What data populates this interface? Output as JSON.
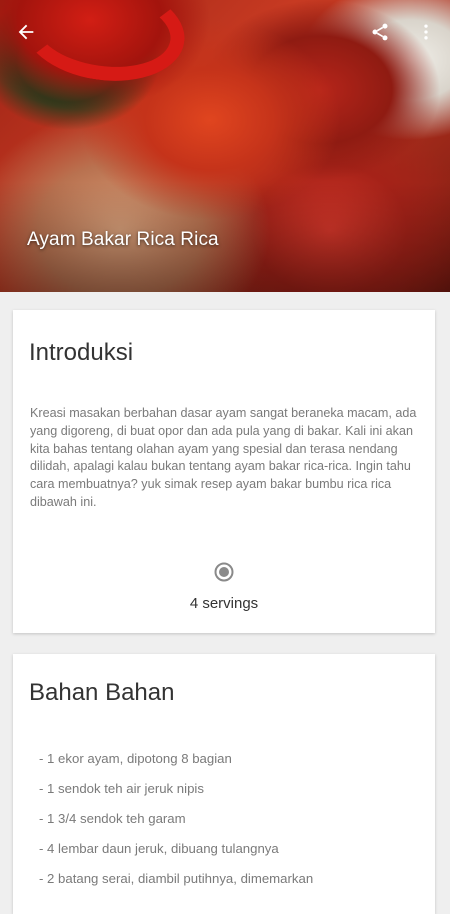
{
  "header": {
    "title": "Ayam Bakar Rica Rica",
    "back_icon": "arrow-back-icon",
    "share_icon": "share-icon",
    "more_icon": "more-vert-icon"
  },
  "intro": {
    "title": "Introduksi",
    "body": "Kreasi masakan berbahan dasar ayam sangat beraneka macam, ada yang digoreng, di buat opor dan ada pula yang di bakar. Kali ini akan kita bahas tentang olahan ayam yang spesial dan terasa nendang dilidah, apalagi kalau bukan tentang ayam bakar rica-rica. Ingin tahu cara membuatnya? yuk simak resep ayam bakar bumbu rica rica dibawah ini.",
    "servings_icon": "servings-dot-icon",
    "servings": "4 servings"
  },
  "ingredients": {
    "title": "Bahan Bahan",
    "items": [
      "- 1 ekor ayam, dipotong 8 bagian",
      "- 1 sendok teh air jeruk nipis",
      "- 1 3/4 sendok teh garam",
      "- 4 lembar daun jeruk, dibuang tulangnya",
      "- 2 batang serai, diambil putihnya, dimemarkan"
    ]
  },
  "colors": {
    "background": "#efefef",
    "card": "#ffffff",
    "title_text": "#333333",
    "body_text": "#7a7a7a"
  }
}
